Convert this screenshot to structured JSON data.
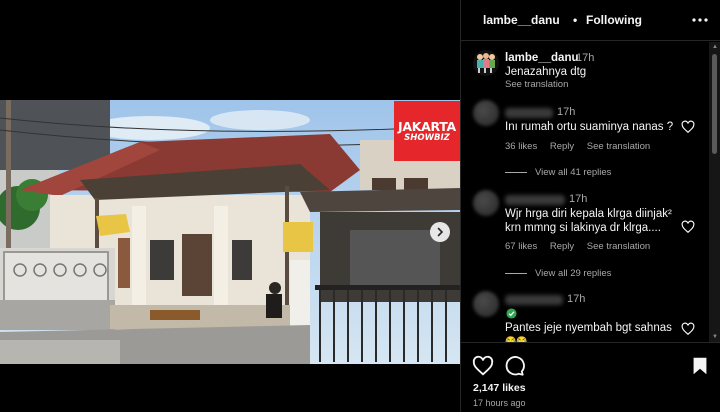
{
  "post": {
    "username": "lambe__danu",
    "separator": "•",
    "follow_status": "Following",
    "media_watermark_line1": "JAKARTA",
    "media_watermark_line2": "SHOWBIZ"
  },
  "caption": {
    "username": "lambe__danu",
    "time": "17h",
    "text": "Jenazahnya dtg",
    "see_translation": "See translation"
  },
  "comments": [
    {
      "time": "17h",
      "text_lines": [
        "Inı rumah ortu suaminya nanas ?"
      ],
      "likes": "36 likes",
      "reply": "Reply",
      "see_translation": "See translation",
      "view_replies": "View all 41 replies"
    },
    {
      "time": "17h",
      "text_lines": [
        "Wjr hrga diri kepala klrga diinjak²",
        "krn mmng si lakinya dr klrga...."
      ],
      "likes": "67 likes",
      "reply": "Reply",
      "see_translation": "See translation",
      "view_replies": "View all 29 replies"
    },
    {
      "time": "17h",
      "text_lines": [
        "Pantes jeje nyembah bgt sahnas",
        "😂😂"
      ]
    }
  ],
  "footer": {
    "likes": "2,147 likes",
    "time_ago": "17 hours ago"
  },
  "colors": {
    "background": "#000000",
    "primary_text": "#f5f5f5",
    "secondary_text": "#a8a8a8",
    "divider": "#262626",
    "watermark_red": "#e5262a",
    "verified_green": "#2fa84f"
  },
  "icons": [
    "more-options-icon",
    "heart-icon",
    "comment-icon",
    "save-bookmark-icon",
    "next-arrow-icon",
    "verified-check-icon"
  ]
}
